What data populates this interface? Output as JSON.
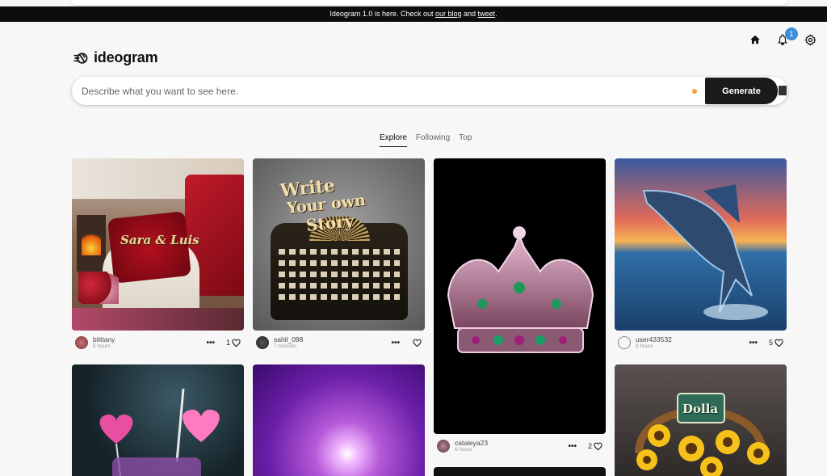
{
  "banner": {
    "pre": "Ideogram 1.0 is here. Check out ",
    "blog": "our blog",
    "mid": " and ",
    "tweet": "tweet",
    "post": "."
  },
  "nav": {
    "notification_count": "1"
  },
  "logo": {
    "text": "ideogram"
  },
  "search": {
    "placeholder": "Describe what you want to see here.",
    "generate_label": "Generate"
  },
  "tabs": [
    {
      "label": "Explore"
    },
    {
      "label": "Following"
    },
    {
      "label": "Top"
    }
  ],
  "image_texts": {
    "pillow": "Sara & Luis",
    "typewriter_line1": "Write",
    "typewriter_line2": "Your own",
    "typewriter_line3": "Story",
    "basket": "Dolla"
  },
  "cards": [
    {
      "user": "btittany",
      "time": "5 hours",
      "likes": "1"
    },
    {
      "user": "sahil_098",
      "time": "7 minutes",
      "likes": ""
    },
    {
      "user": "cataleya23",
      "time": "6 hours",
      "likes": "2"
    },
    {
      "user": "user433532",
      "time": "8 hours",
      "likes": "5"
    }
  ],
  "colors": {
    "accent": "#3a8ed8",
    "dark": "#1b1b1b",
    "dot": "#f2a23b"
  }
}
